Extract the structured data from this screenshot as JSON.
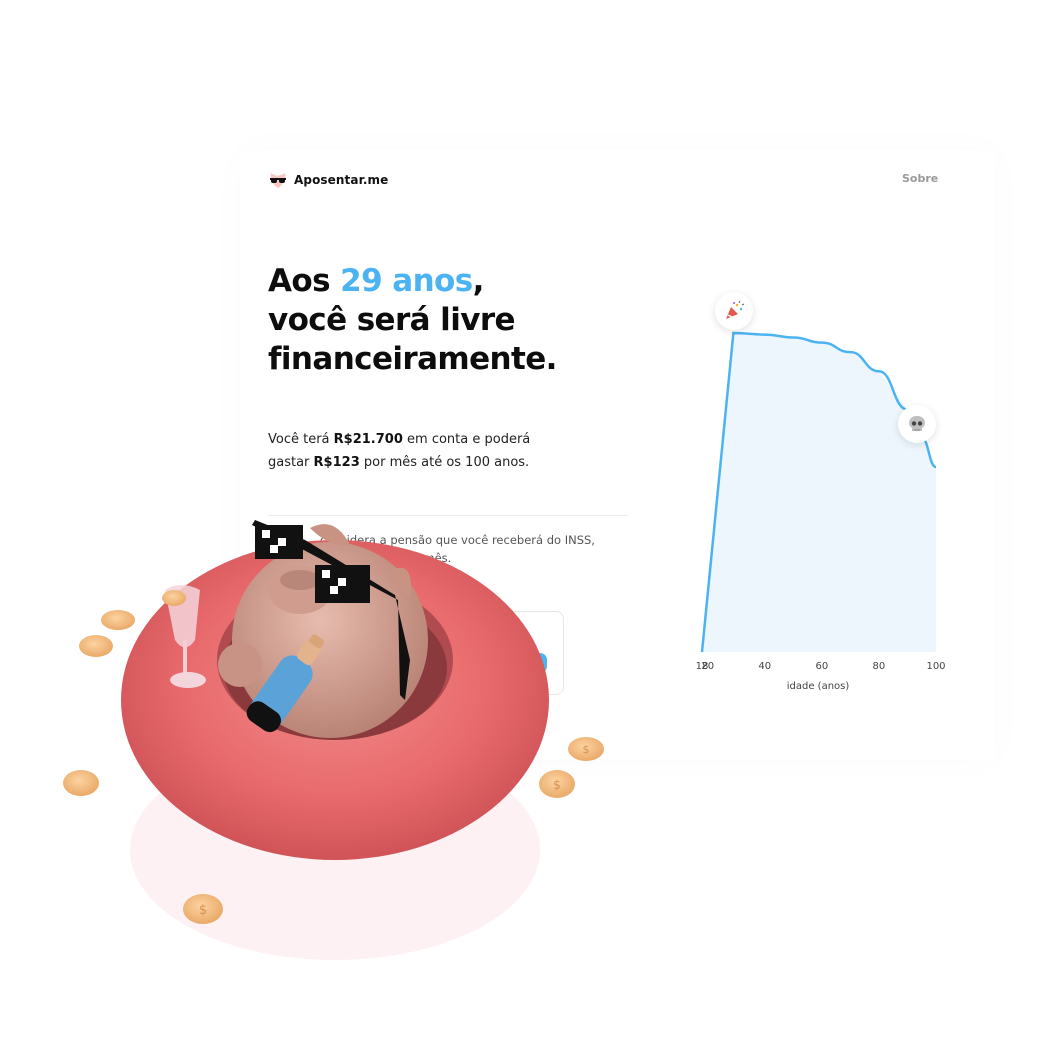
{
  "brand": {
    "name": "Aposentar.me"
  },
  "nav": {
    "about": "Sobre"
  },
  "headline": {
    "prefix": "Aos ",
    "accent": "29 anos",
    "suffix": ",",
    "line2": "você será livre",
    "line3": "financeiramente."
  },
  "summary": {
    "t1": "Você terá ",
    "amount_balance": "R$21.700",
    "t2": " em conta e poderá",
    "t3": "gastar ",
    "amount_monthly": "R$123",
    "t4": " por mês até os 100 anos."
  },
  "note": {
    "line1": "considera a pensão que você receberá do INSS,",
    "line2": "r mês."
  },
  "colors": {
    "accent": "#4bb3f2",
    "area_fill": "#eef6fd",
    "float_ring": "#e8696b"
  },
  "icons": {
    "retire_marker": "party-popper-icon",
    "end_marker": "skull-icon",
    "logo": "sunglasses-logo-icon"
  },
  "chart_data": {
    "type": "area",
    "xlabel": "idade (anos)",
    "xlim": [
      18,
      100
    ],
    "x_ticks": [
      "18",
      "20",
      "40",
      "60",
      "80",
      "100"
    ],
    "series": [
      {
        "x": [
          18,
          29,
          40,
          50,
          60,
          70,
          80,
          90,
          95,
          100
        ],
        "y": [
          0,
          100,
          99.5,
          98.6,
          97,
          94,
          88,
          76,
          67,
          58
        ]
      }
    ],
    "markers": [
      {
        "x": 29,
        "icon": "party-popper-icon"
      },
      {
        "x": 95,
        "icon": "skull-icon"
      }
    ],
    "grid": false
  }
}
